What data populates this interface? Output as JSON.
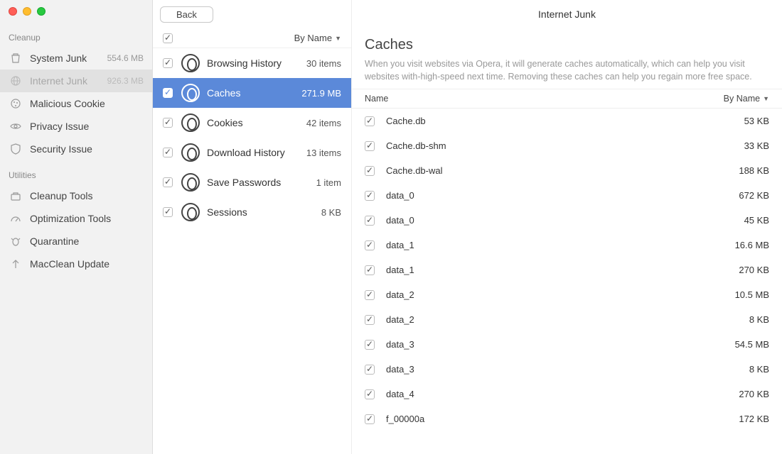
{
  "window": {
    "title": "Internet Junk"
  },
  "sidebar": {
    "sections": [
      {
        "label": "Cleanup",
        "items": [
          {
            "icon": "trash",
            "label": "System Junk",
            "value": "554.6 MB",
            "active": false
          },
          {
            "icon": "globe",
            "label": "Internet Junk",
            "value": "926.3 MB",
            "active": true
          },
          {
            "icon": "cookie",
            "label": "Malicious Cookie",
            "value": "",
            "active": false
          },
          {
            "icon": "eye",
            "label": "Privacy Issue",
            "value": "",
            "active": false
          },
          {
            "icon": "shield",
            "label": "Security Issue",
            "value": "",
            "active": false
          }
        ]
      },
      {
        "label": "Utilities",
        "items": [
          {
            "icon": "toolbox",
            "label": "Cleanup Tools",
            "value": "",
            "active": false
          },
          {
            "icon": "gauge",
            "label": "Optimization Tools",
            "value": "",
            "active": false
          },
          {
            "icon": "bug",
            "label": "Quarantine",
            "value": "",
            "active": false
          },
          {
            "icon": "arrow-up",
            "label": "MacClean Update",
            "value": "",
            "active": false
          }
        ]
      }
    ]
  },
  "mid": {
    "back": "Back",
    "sort": "By Name",
    "categories": [
      {
        "label": "Browsing History",
        "value": "30 items",
        "selected": false
      },
      {
        "label": "Caches",
        "value": "271.9 MB",
        "selected": true
      },
      {
        "label": "Cookies",
        "value": "42 items",
        "selected": false
      },
      {
        "label": "Download History",
        "value": "13 items",
        "selected": false
      },
      {
        "label": "Save Passwords",
        "value": "1 item",
        "selected": false
      },
      {
        "label": "Sessions",
        "value": "8 KB",
        "selected": false
      }
    ]
  },
  "detail": {
    "title": "Caches",
    "description": "When you visit websites via Opera, it will generate caches automatically, which can help you visit websites with-high-speed next time. Removing these caches can help you regain more free space.",
    "table": {
      "nameHeader": "Name",
      "sort": "By Name"
    },
    "files": [
      {
        "name": "Cache.db",
        "size": "53 KB"
      },
      {
        "name": "Cache.db-shm",
        "size": "33 KB"
      },
      {
        "name": "Cache.db-wal",
        "size": "188 KB"
      },
      {
        "name": "data_0",
        "size": "672 KB"
      },
      {
        "name": "data_0",
        "size": "45 KB"
      },
      {
        "name": "data_1",
        "size": "16.6 MB"
      },
      {
        "name": "data_1",
        "size": "270 KB"
      },
      {
        "name": "data_2",
        "size": "10.5 MB"
      },
      {
        "name": "data_2",
        "size": "8 KB"
      },
      {
        "name": "data_3",
        "size": "54.5 MB"
      },
      {
        "name": "data_3",
        "size": "8 KB"
      },
      {
        "name": "data_4",
        "size": "270 KB"
      },
      {
        "name": "f_00000a",
        "size": "172 KB"
      }
    ]
  }
}
